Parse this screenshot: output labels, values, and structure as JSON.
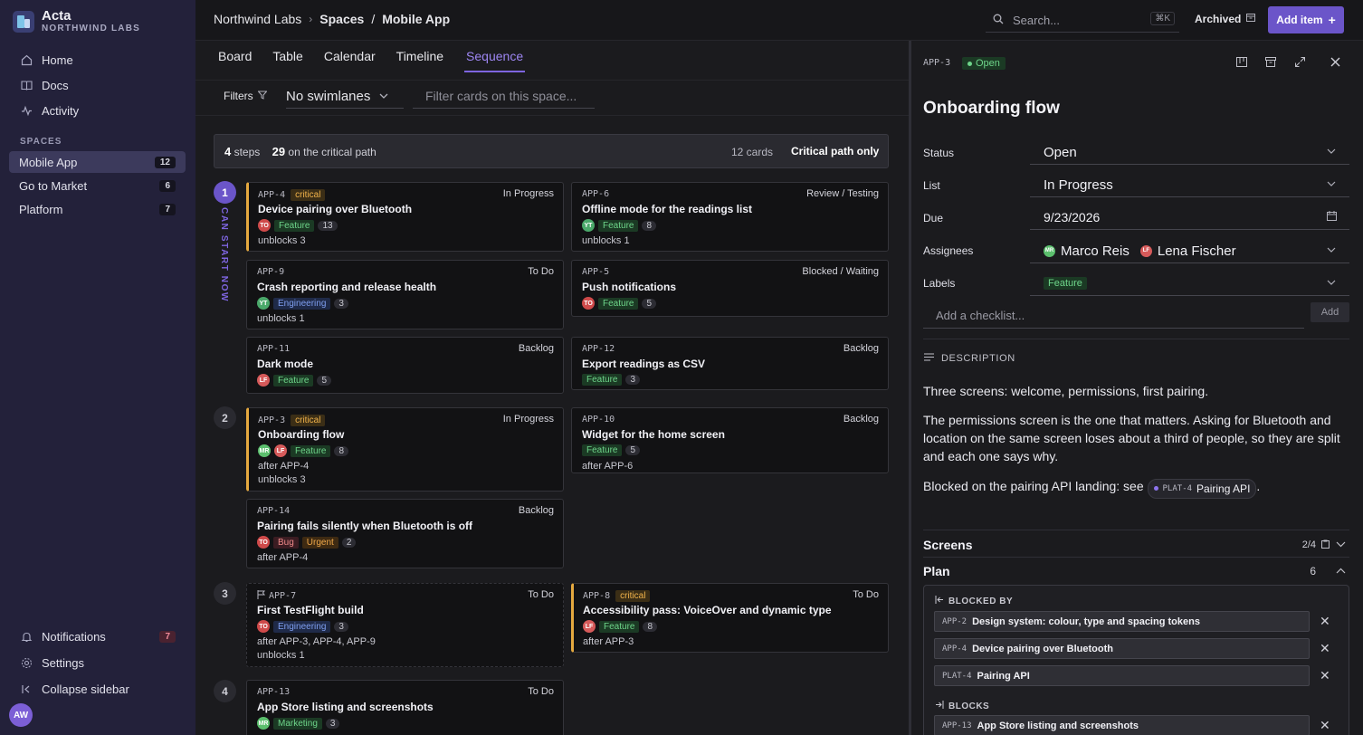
{
  "brand": {
    "name": "Acta",
    "org": "NORTHWIND LABS"
  },
  "nav": [
    {
      "label": "Home",
      "icon": "home-icon"
    },
    {
      "label": "Docs",
      "icon": "docs-icon"
    },
    {
      "label": "Activity",
      "icon": "activity-icon"
    }
  ],
  "spaces_label": "SPACES",
  "spaces": [
    {
      "label": "Mobile App",
      "count": "12"
    },
    {
      "label": "Go to Market",
      "count": "6"
    },
    {
      "label": "Platform",
      "count": "7"
    }
  ],
  "footer": {
    "notifications": "Notifications",
    "notifications_count": "7",
    "settings": "Settings",
    "collapse": "Collapse sidebar",
    "avatar": "AW"
  },
  "breadcrumb": {
    "org": "Northwind Labs",
    "spaces": "Spaces",
    "slash": "/",
    "current": "Mobile App"
  },
  "search": {
    "placeholder": "Search...",
    "shortcut": "⌘K"
  },
  "archived": "Archived",
  "add_item": "Add item",
  "tabs": [
    "Board",
    "Table",
    "Calendar",
    "Timeline",
    "Sequence"
  ],
  "filters": {
    "label": "Filters",
    "swimlane": "No swimlanes",
    "filter_placeholder": "Filter cards on this space..."
  },
  "summary": {
    "steps": "4",
    "steps_label": "steps",
    "critical": "29",
    "critical_label": "on the critical path",
    "cards": "12 cards",
    "critical_only": "Critical path only"
  },
  "can_start": "CAN START NOW",
  "steps": [
    "1",
    "2",
    "3",
    "4"
  ],
  "cards": [
    {
      "key": "APP-4",
      "critical": "critical",
      "status": "In Progress",
      "title": "Device pairing over Bluetooth",
      "avatars": [
        "TO"
      ],
      "labels": [
        "Feature"
      ],
      "num": "13",
      "lines": [
        "unblocks 3"
      ]
    },
    {
      "key": "APP-6",
      "status": "Review / Testing",
      "title": "Offline mode for the readings list",
      "avatars": [
        "YT"
      ],
      "labels": [
        "Feature"
      ],
      "num": "8",
      "lines": [
        "unblocks 1"
      ]
    },
    {
      "key": "APP-9",
      "status": "To Do",
      "title": "Crash reporting and release health",
      "avatars": [
        "YT"
      ],
      "labels": [
        "Engineering"
      ],
      "num": "3",
      "lines": [
        "unblocks 1"
      ]
    },
    {
      "key": "APP-5",
      "status": "Blocked / Waiting",
      "title": "Push notifications",
      "avatars": [
        "TO"
      ],
      "labels": [
        "Feature"
      ],
      "num": "5",
      "lines": []
    },
    {
      "key": "APP-11",
      "status": "Backlog",
      "title": "Dark mode",
      "avatars": [
        "LF"
      ],
      "labels": [
        "Feature"
      ],
      "num": "5",
      "lines": []
    },
    {
      "key": "APP-12",
      "status": "Backlog",
      "title": "Export readings as CSV",
      "avatars": [],
      "labels": [
        "Feature"
      ],
      "num": "3",
      "lines": []
    },
    {
      "key": "APP-3",
      "critical": "critical",
      "status": "In Progress",
      "title": "Onboarding flow",
      "avatars": [
        "MR",
        "LF"
      ],
      "labels": [
        "Feature"
      ],
      "num": "8",
      "lines": [
        "after APP-4",
        "unblocks 3"
      ]
    },
    {
      "key": "APP-10",
      "status": "Backlog",
      "title": "Widget for the home screen",
      "avatars": [],
      "labels": [
        "Feature"
      ],
      "num": "5",
      "lines": [
        "after APP-6"
      ]
    },
    {
      "key": "APP-14",
      "status": "Backlog",
      "title": "Pairing fails silently when Bluetooth is off",
      "avatars": [
        "TO"
      ],
      "labels": [
        "Bug",
        "Urgent"
      ],
      "num": "2",
      "lines": [
        "after APP-4"
      ]
    },
    {
      "key": "APP-7",
      "status": "To Do",
      "title": "First TestFlight build",
      "avatars": [
        "TO"
      ],
      "labels": [
        "Engineering"
      ],
      "num": "3",
      "lines": [
        "after APP-3, APP-4, APP-9",
        "unblocks 1"
      ]
    },
    {
      "key": "APP-8",
      "critical": "critical",
      "status": "To Do",
      "title": "Accessibility pass: VoiceOver and dynamic type",
      "avatars": [
        "LF"
      ],
      "labels": [
        "Feature"
      ],
      "num": "8",
      "lines": [
        "after APP-3"
      ]
    },
    {
      "key": "APP-13",
      "status": "To Do",
      "title": "App Store listing and screenshots",
      "avatars": [
        "MR"
      ],
      "labels": [
        "Marketing"
      ],
      "num": "3",
      "lines": []
    }
  ],
  "detail": {
    "key": "APP-3",
    "status_badge": "Open",
    "title": "Onboarding flow",
    "fields": {
      "status_label": "Status",
      "status": "Open",
      "list_label": "List",
      "list": "In Progress",
      "due_label": "Due",
      "due": "9/23/2026",
      "assignees_label": "Assignees",
      "assignee1": "Marco Reis",
      "assignee1_initials": "MR",
      "assignee2": "Lena Fischer",
      "assignee2_initials": "LF",
      "labels_label": "Labels",
      "label": "Feature"
    },
    "checklist_placeholder": "Add a checklist...",
    "add": "Add",
    "description_heading": "DESCRIPTION",
    "p1": "Three screens: welcome, permissions, first pairing.",
    "p2": "The permissions screen is the one that matters. Asking for Bluetooth and location on the same screen loses about a third of people, so they are split and each one says why.",
    "p3": "Blocked on the pairing API landing: see",
    "p3_chip_key": "PLAT-4",
    "p3_chip_title": "Pairing API",
    "p3_end": ".",
    "screens": {
      "name": "Screens",
      "count": "2/4"
    },
    "plan": {
      "name": "Plan",
      "count": "6"
    },
    "blocked_by_label": "BLOCKED BY",
    "blocked_by": [
      {
        "key": "APP-2",
        "title": "Design system: colour, type and spacing tokens"
      },
      {
        "key": "APP-4",
        "title": "Device pairing over Bluetooth"
      },
      {
        "key": "PLAT-4",
        "title": "Pairing API"
      }
    ],
    "blocks_label": "BLOCKS",
    "blocks": [
      {
        "key": "APP-13",
        "title": "App Store listing and screenshots"
      }
    ]
  },
  "colors": {
    "accent": "#6b55c9",
    "critical": "#e5a93f",
    "feature": "#6ed58a"
  }
}
